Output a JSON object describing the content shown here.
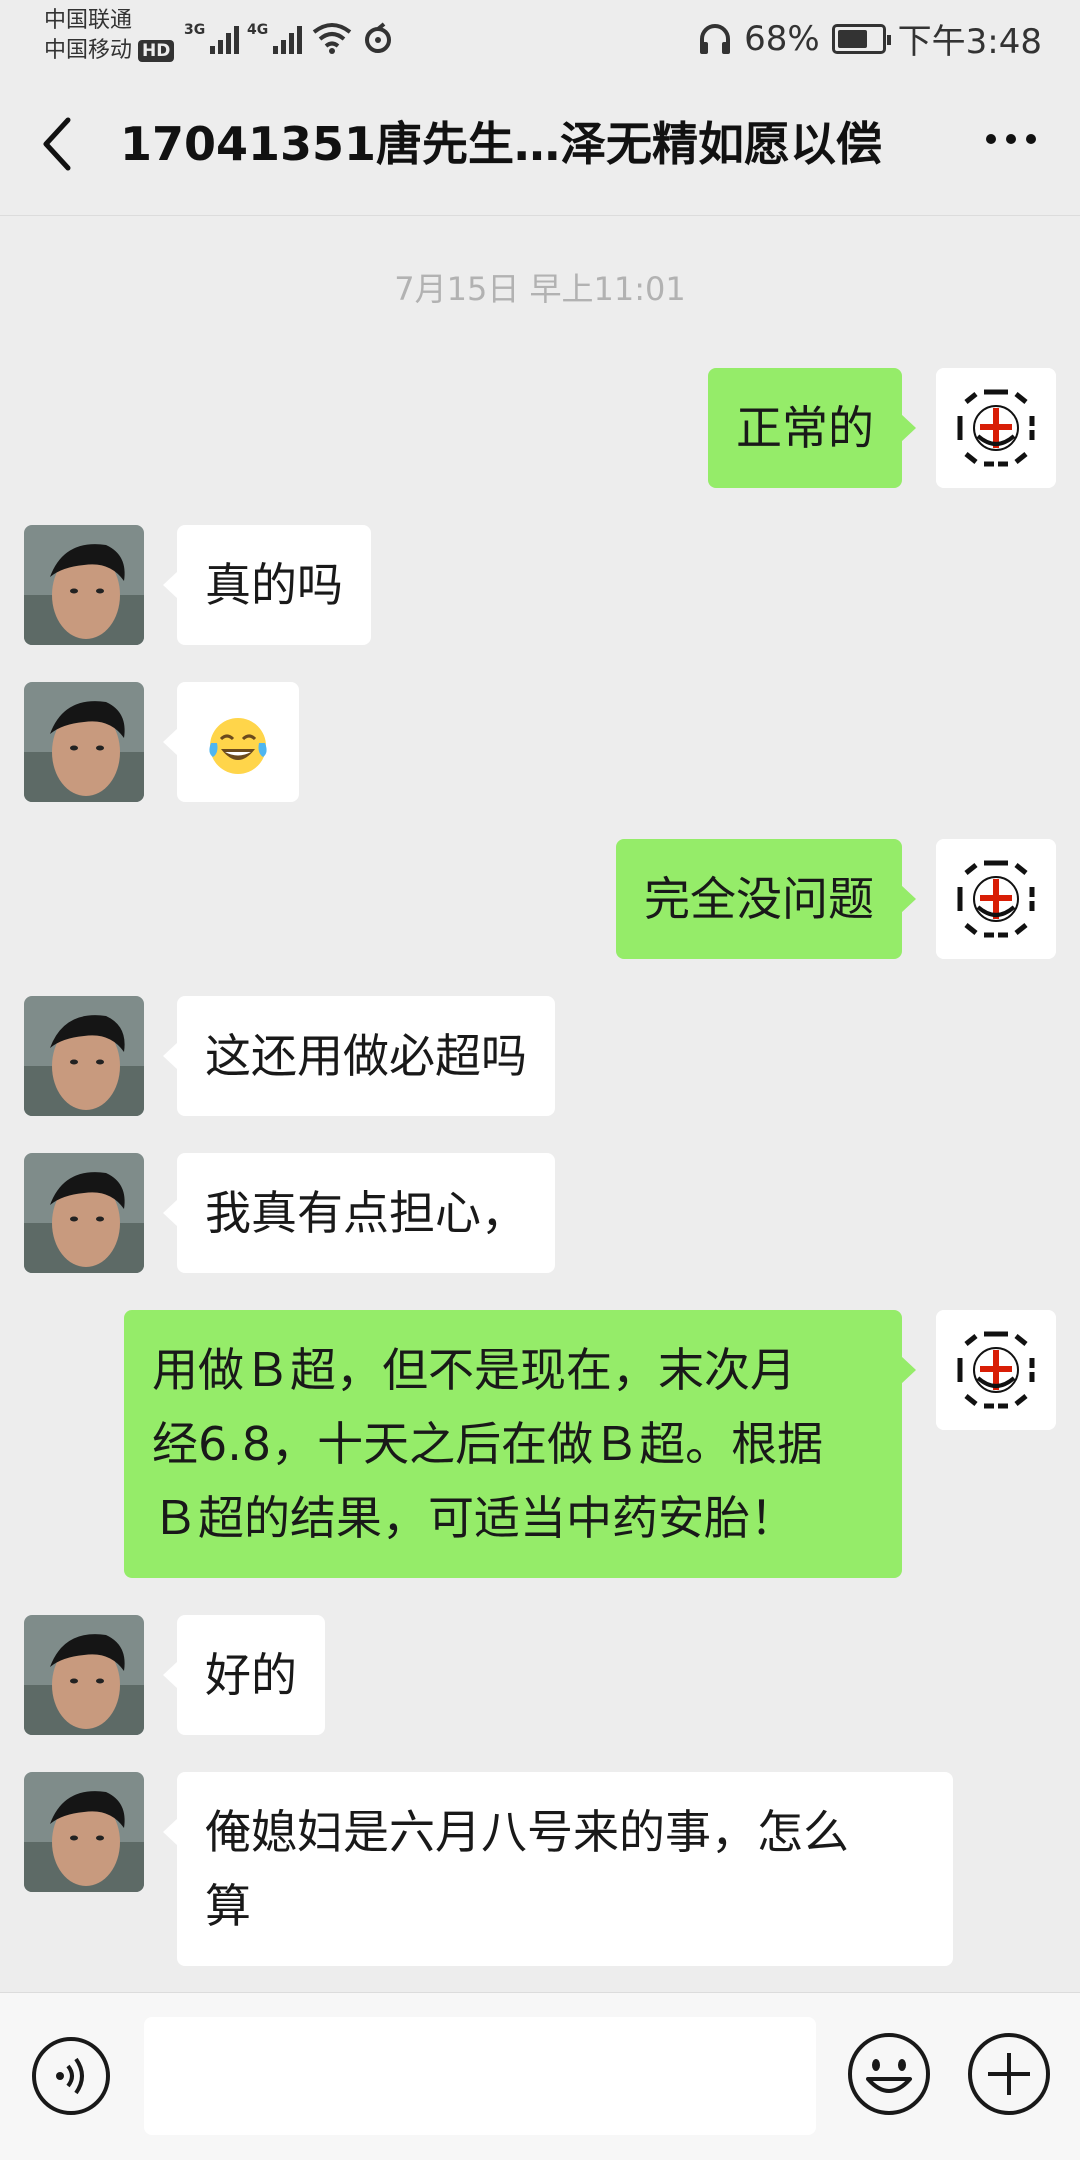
{
  "status_bar": {
    "carrier_1": "中国联通",
    "carrier_2": "中国移动",
    "hd_badge": "HD",
    "signal_1_tag": "3G",
    "signal_2_tag": "4G",
    "battery_percent": "68%",
    "battery_level": 0.68,
    "time": "下午3:48",
    "icons": [
      "wifi-icon",
      "sync-icon",
      "headphones-icon",
      "battery-icon"
    ]
  },
  "header": {
    "title": "17041351唐先生…泽无精如愿以偿",
    "back_icon": "chevron-left-icon",
    "more_icon": "more-dots-icon"
  },
  "chat": {
    "timestamp": "7月15日 早上11:01",
    "messages": [
      {
        "side": "right",
        "text": "正常的"
      },
      {
        "side": "left",
        "text": "真的吗"
      },
      {
        "side": "left",
        "emoji": "tears-of-joy-icon"
      },
      {
        "side": "right",
        "text": "完全没问题"
      },
      {
        "side": "left",
        "text": "这还用做必超吗"
      },
      {
        "side": "left",
        "text": "我真有点担心，"
      },
      {
        "side": "right",
        "lines": [
          "用做Ｂ超，但不是现在，末次月",
          "经6.8，十天之后在做Ｂ超。根据",
          "Ｂ超的结果，可适当中药安胎！"
        ]
      },
      {
        "side": "left",
        "text": "好的"
      },
      {
        "side": "left",
        "lines": [
          "俺媳妇是六月八号来的事，怎么",
          "算"
        ]
      }
    ]
  },
  "input_bar": {
    "text_value": "",
    "icons": [
      "voice-icon",
      "emoji-icon",
      "plus-icon"
    ]
  },
  "colors": {
    "background": "#ededed",
    "sent_bubble": "#95ec69",
    "received_bubble": "#ffffff",
    "timestamp_text": "#b2b2b2"
  }
}
